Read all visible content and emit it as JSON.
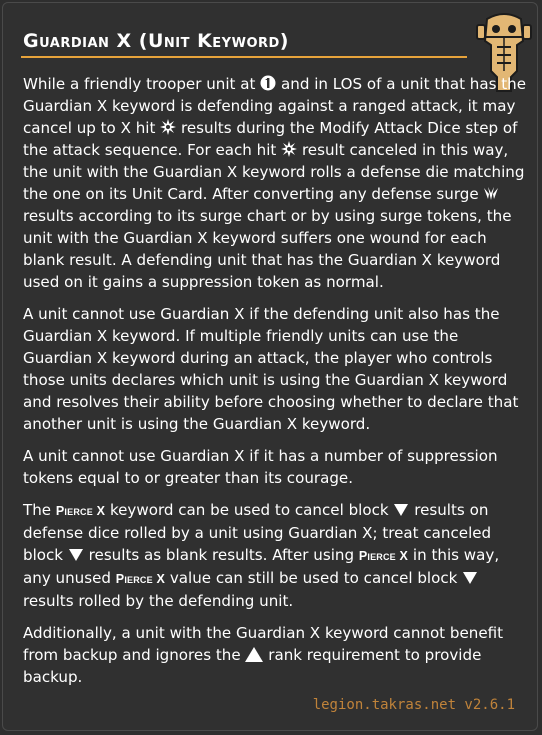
{
  "header": {
    "title": "Guardian X (Unit Keyword)"
  },
  "icons": {
    "range": "range-1-icon",
    "hit": "hit-icon",
    "surge": "defense-surge-icon",
    "block": "block-icon",
    "rank": "rank-triangle-icon",
    "droid": "droid-head-icon"
  },
  "colors": {
    "accent": "#e7a33b",
    "footer": "#c0833a",
    "background": "#303030",
    "text": "#ffffff"
  },
  "paragraphs": {
    "p1": {
      "s1": "While a friendly trooper unit at ",
      "s2": " and in LOS of a unit that has the Guardian X keyword is defending against a ranged attack, it may cancel up to X hit ",
      "s3": " results during the Modify Attack Dice step of the attack sequence. For each hit ",
      "s4": " result canceled in this way, the unit with the Guardian X keyword rolls a defense die matching the one on its Unit Card. After converting any defense surge ",
      "s5": " results according to its surge chart or by using surge tokens, the unit with the Guardian X keyword suffers one wound for each blank result. A defending unit that has the Guardian X keyword used on it gains a suppression token as normal."
    },
    "p2": "A unit cannot use Guardian X if the defending unit also has the Guardian X keyword. If multiple friendly units can use the Guardian X keyword during an attack, the player who controls those units declares which unit is using the Guardian X keyword and resolves their ability before choosing whether to declare that another unit is using the Guardian X keyword.",
    "p3": "A unit cannot use Guardian X if it has a number of suppression tokens equal to or greater than its courage.",
    "p4": {
      "s1": "The ",
      "kw": "Pierce X",
      "s2": " keyword can be used to cancel block ",
      "s3": " results on defense dice rolled by a unit using Guardian X; treat canceled block ",
      "s4": " results as blank results. After using ",
      "s5": " in this way, any unused ",
      "s6": " value can still be used to cancel block ",
      "s7": " results rolled by the defending unit."
    },
    "p5": {
      "s1": "Additionally, a unit with the Guardian X keyword cannot benefit from backup and ignores the ",
      "s2": " rank requirement to provide backup."
    }
  },
  "footer": {
    "text": "legion.takras.net v2.6.1"
  }
}
